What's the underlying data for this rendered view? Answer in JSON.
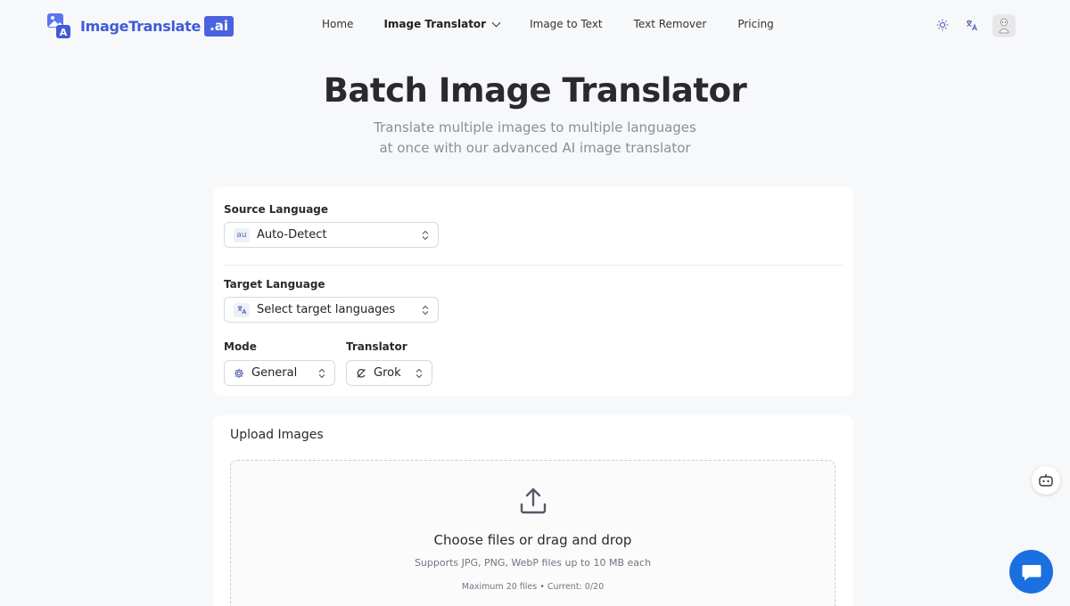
{
  "header": {
    "logo_text": "ImageTranslate",
    "logo_badge": ".ai",
    "nav": [
      {
        "label": "Home"
      },
      {
        "label": "Image Translator"
      },
      {
        "label": "Image to Text"
      },
      {
        "label": "Text Remover"
      },
      {
        "label": "Pricing"
      }
    ],
    "icons": [
      "sun-icon",
      "translate-icon",
      "avatar"
    ]
  },
  "hero": {
    "title": "Batch Image Translator",
    "subtitle_line1": "Translate multiple images to multiple languages",
    "subtitle_line2": "at once with our advanced AI image translator"
  },
  "settings": {
    "source_label": "Source Language",
    "source_icon_text": "au",
    "source_value": "Auto-Detect",
    "target_label": "Target Language",
    "target_value": "Select target languages",
    "mode_label": "Mode",
    "mode_value": "General",
    "translator_label": "Translator",
    "translator_value": "Grok"
  },
  "upload": {
    "title": "Upload Images",
    "main_text": "Choose files or drag and drop",
    "sub_text": "Supports JPG, PNG, WebP files up to 10 MB each",
    "limit_text": "Maximum 20 files • Current: 0/20"
  },
  "colors": {
    "brand": "#4a63e0",
    "chat_button": "#1c6fe0",
    "background": "#f7f8fa"
  }
}
